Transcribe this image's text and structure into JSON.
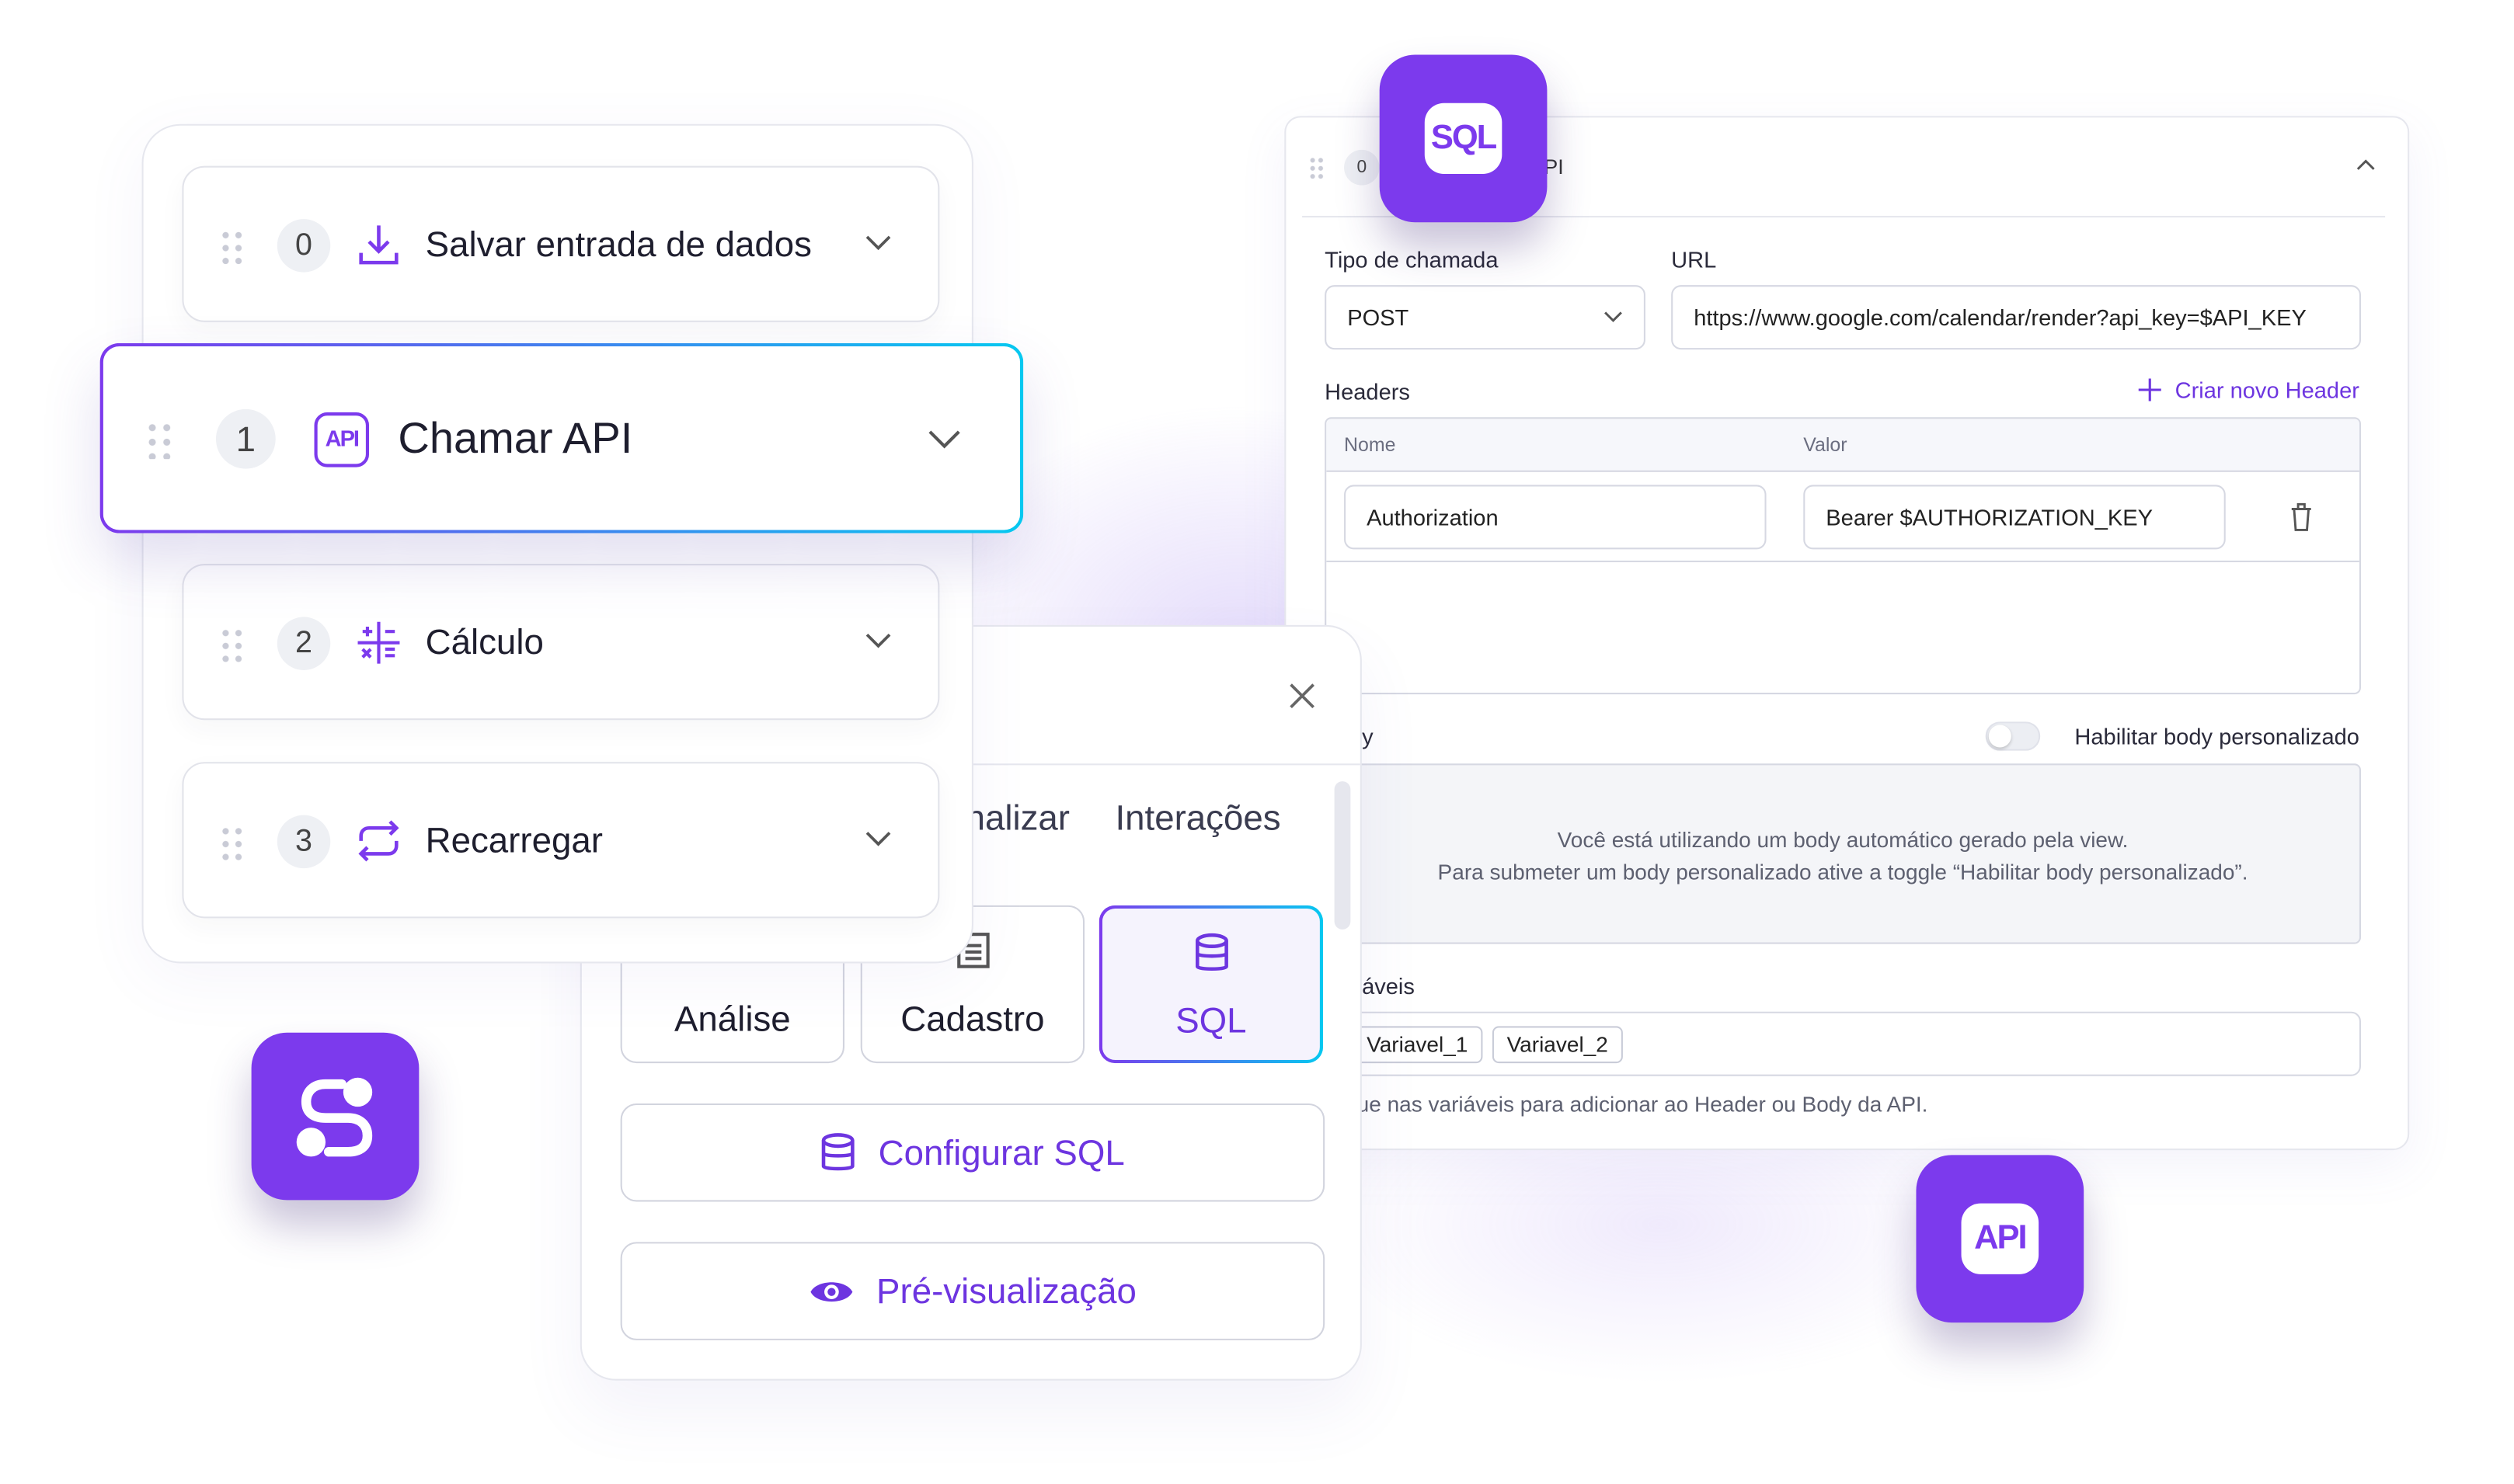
{
  "colors": {
    "accent": "#7c3aed",
    "accent_text": "#6d35e0",
    "gradient_end": "#06c8f0",
    "border": "#d6d8e2"
  },
  "api_panel": {
    "step_number": "0",
    "title_fragment": "PI",
    "call_type_label": "Tipo de chamada",
    "call_type_value": "POST",
    "url_label": "URL",
    "url_value": "https://www.google.com/calendar/render?api_key=$API_KEY",
    "headers_label": "Headers",
    "add_header_label": "Criar novo Header",
    "headers_columns": [
      "Nome",
      "Valor"
    ],
    "headers_rows": [
      {
        "name": "Authorization",
        "value": "Bearer $AUTHORIZATION_KEY"
      }
    ],
    "body_label_fragment": "ly",
    "custom_body_toggle_label": "Habilitar body personalizado",
    "custom_body_enabled": false,
    "body_info_line1": "Você está utilizando um body automático gerado pela view.",
    "body_info_line2": "Para submeter um body personalizado ative a toggle “Habilitar body personalizado”.",
    "variables_label_fragment": "iáveis",
    "variables": [
      "Variavel_1",
      "Variavel_2"
    ],
    "variables_hint_fragment": "ue nas variáveis para adicionar ao Header ou Body da API."
  },
  "modal": {
    "tabs": [
      "nalizar",
      "Interações"
    ],
    "options": [
      {
        "label": "Análise",
        "icon": "chart-icon"
      },
      {
        "label": "Cadastro",
        "icon": "form-icon"
      },
      {
        "label": "SQL",
        "icon": "database-icon",
        "selected": true
      }
    ],
    "configure_button": "Configurar SQL",
    "preview_button": "Pré-visualização"
  },
  "steps": [
    {
      "number": "0",
      "label": "Salvar entrada de dados",
      "icon": "download-icon"
    },
    {
      "number": "1",
      "label": "Chamar API",
      "icon": "api-icon",
      "active": true
    },
    {
      "number": "2",
      "label": "Cálculo",
      "icon": "calculator-icon"
    },
    {
      "number": "3",
      "label": "Recarregar",
      "icon": "repeat-icon"
    }
  ],
  "app_icons": {
    "sql": "SQL",
    "api": "API"
  }
}
